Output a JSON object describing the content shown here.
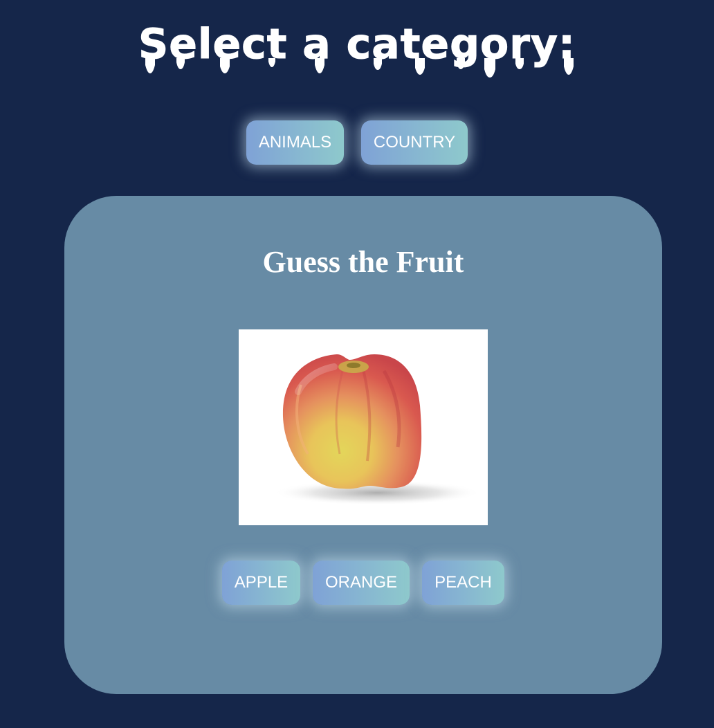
{
  "header": {
    "title": "Select a category:"
  },
  "categories": [
    {
      "label": "ANIMALS"
    },
    {
      "label": "COUNTRY"
    }
  ],
  "quiz": {
    "title": "Guess the Fruit",
    "image_subject": "apple",
    "answers": [
      {
        "label": "APPLE"
      },
      {
        "label": "ORANGE"
      },
      {
        "label": "PEACH"
      }
    ]
  },
  "colors": {
    "background": "#15264a",
    "card": "#678ba5",
    "button_gradient_start": "#7fa2d6",
    "button_gradient_end": "#8ec9cc",
    "text": "#ffffff"
  }
}
